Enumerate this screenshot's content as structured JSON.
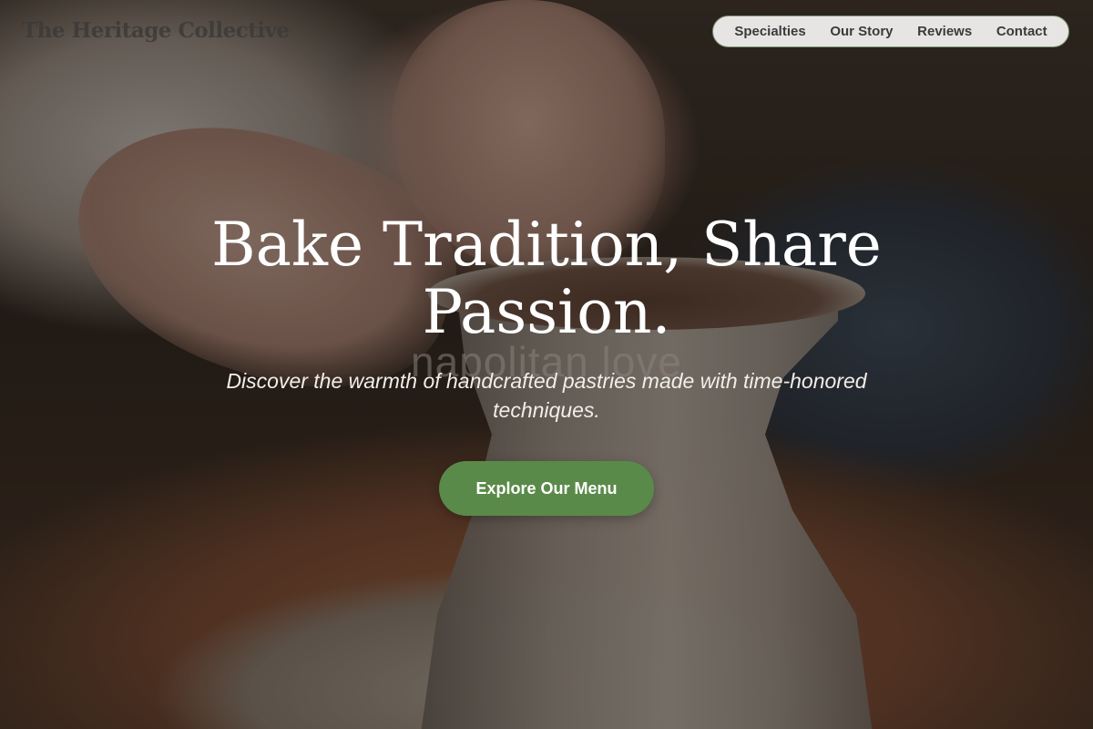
{
  "header": {
    "logo_text": "The Heritage Collective",
    "nav": [
      {
        "label": "Specialties"
      },
      {
        "label": "Our Story"
      },
      {
        "label": "Reviews"
      },
      {
        "label": "Contact"
      }
    ]
  },
  "hero": {
    "background_image": "pottery-wheel-photo",
    "title": "Bake Tradition, Share Passion.",
    "watermark": "napolitan love",
    "subtitle": "Discover the warmth of handcrafted pastries made with time-honored techniques.",
    "cta_label": "Explore Our Menu"
  },
  "colors": {
    "accent": "#5a8a49",
    "nav_bg": "#f0f0ee",
    "nav_border": "#7a8f6e",
    "title_text": "#ffffff"
  }
}
